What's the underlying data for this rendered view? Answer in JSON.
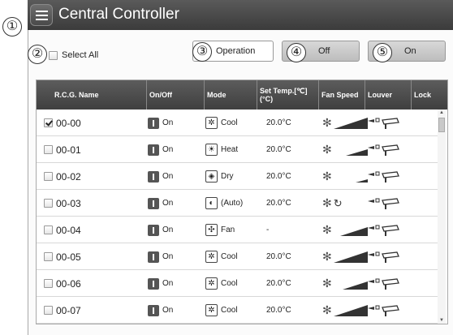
{
  "app": {
    "title": "Central Controller"
  },
  "callouts": [
    "①",
    "②",
    "③",
    "④",
    "⑤"
  ],
  "toolbar": {
    "select_all_label": "Select All",
    "operation_label": "Operation",
    "off_label": "Off",
    "on_label": "On"
  },
  "table": {
    "headers": [
      "R.C.G. Name",
      "On/Off",
      "Mode",
      "Set Temp.[℃](°C)",
      "Fan Speed",
      "Louver",
      "Lock"
    ],
    "rows": [
      {
        "name": "00-00",
        "checked": true,
        "onoff": "On",
        "mode": "Cool",
        "mode_icon": "cool-icon",
        "temp": "20.0°C",
        "fan_level": 1.0
      },
      {
        "name": "00-01",
        "checked": false,
        "onoff": "On",
        "mode": "Heat",
        "mode_icon": "heat-icon",
        "temp": "20.0°C",
        "fan_level": 0.6
      },
      {
        "name": "00-02",
        "checked": false,
        "onoff": "On",
        "mode": "Dry",
        "mode_icon": "dry-icon",
        "temp": "20.0°C",
        "fan_level": 0.3
      },
      {
        "name": "00-03",
        "checked": false,
        "onoff": "On",
        "mode": "(Auto)",
        "mode_icon": "auto-icon",
        "temp": "20.0°C",
        "fan_level": 0
      },
      {
        "name": "00-04",
        "checked": false,
        "onoff": "On",
        "mode": "Fan",
        "mode_icon": "fan-icon",
        "temp": "-",
        "fan_level": 0.8
      },
      {
        "name": "00-05",
        "checked": false,
        "onoff": "On",
        "mode": "Cool",
        "mode_icon": "cool-icon",
        "temp": "20.0°C",
        "fan_level": 1.0
      },
      {
        "name": "00-06",
        "checked": false,
        "onoff": "On",
        "mode": "Cool",
        "mode_icon": "cool-icon",
        "temp": "20.0°C",
        "fan_level": 0.7
      },
      {
        "name": "00-07",
        "checked": false,
        "onoff": "On",
        "mode": "Cool",
        "mode_icon": "cool-icon",
        "temp": "20.0°C",
        "fan_level": 1.0
      }
    ]
  }
}
